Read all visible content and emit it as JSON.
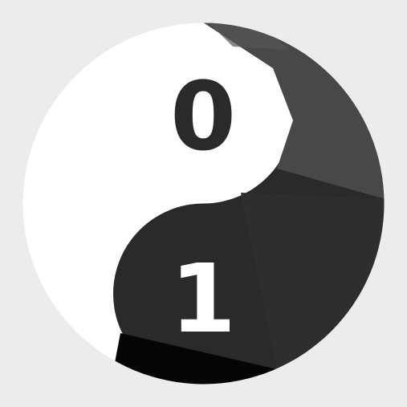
{
  "logo": {
    "top_digit": "0",
    "bottom_digit": "1"
  },
  "colors": {
    "background": "#ececec",
    "light_half": "#ffffff",
    "dark_half": "#2a2a2a",
    "dark_facet_top": "#484848",
    "dark_facet_mid": "#3a3a3a",
    "dark_facet_bottom": "#050505",
    "digit_on_light": "#2a2a2a",
    "digit_on_dark": "#ffffff"
  }
}
